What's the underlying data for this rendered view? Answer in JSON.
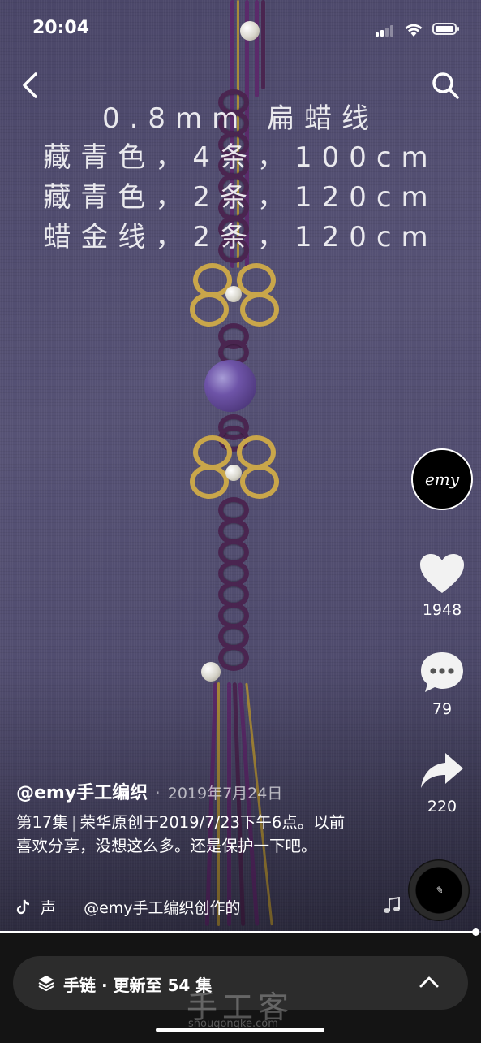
{
  "status_bar": {
    "time": "20:04"
  },
  "overlay": {
    "lines": [
      "0.8mm 扁蜡线",
      "藏青色，4条，100cm",
      "藏青色，2条，120cm",
      "蜡金线，2条，120cm"
    ]
  },
  "nav": {
    "back_icon": "back-arrow-icon",
    "search_icon": "search-icon"
  },
  "actions": {
    "avatar_text": "emy",
    "likes": "1948",
    "comments": "79",
    "shares": "220"
  },
  "post": {
    "author": "@emy手工编织",
    "separator": "·",
    "date": "2019年7月24日",
    "episode": "第17集",
    "episode_sep": "|",
    "description": "荣华原创于2019/7/23下午6点。以前喜欢分享，没想这么多。还是保护一下吧。",
    "music_prefix": "声",
    "music": "@emy手工编织创作的"
  },
  "playback": {
    "progress": 0.99
  },
  "series": {
    "label": "手链 · 更新至 54 集"
  },
  "watermark": {
    "text": "手工客",
    "url": "shougongke.com"
  },
  "colors": {
    "background": "#4f4b6d",
    "bottom_bar": "#141414",
    "series_bar": "#2c2c2c",
    "gold": "#c9a64a",
    "cord": "#4a2550"
  }
}
